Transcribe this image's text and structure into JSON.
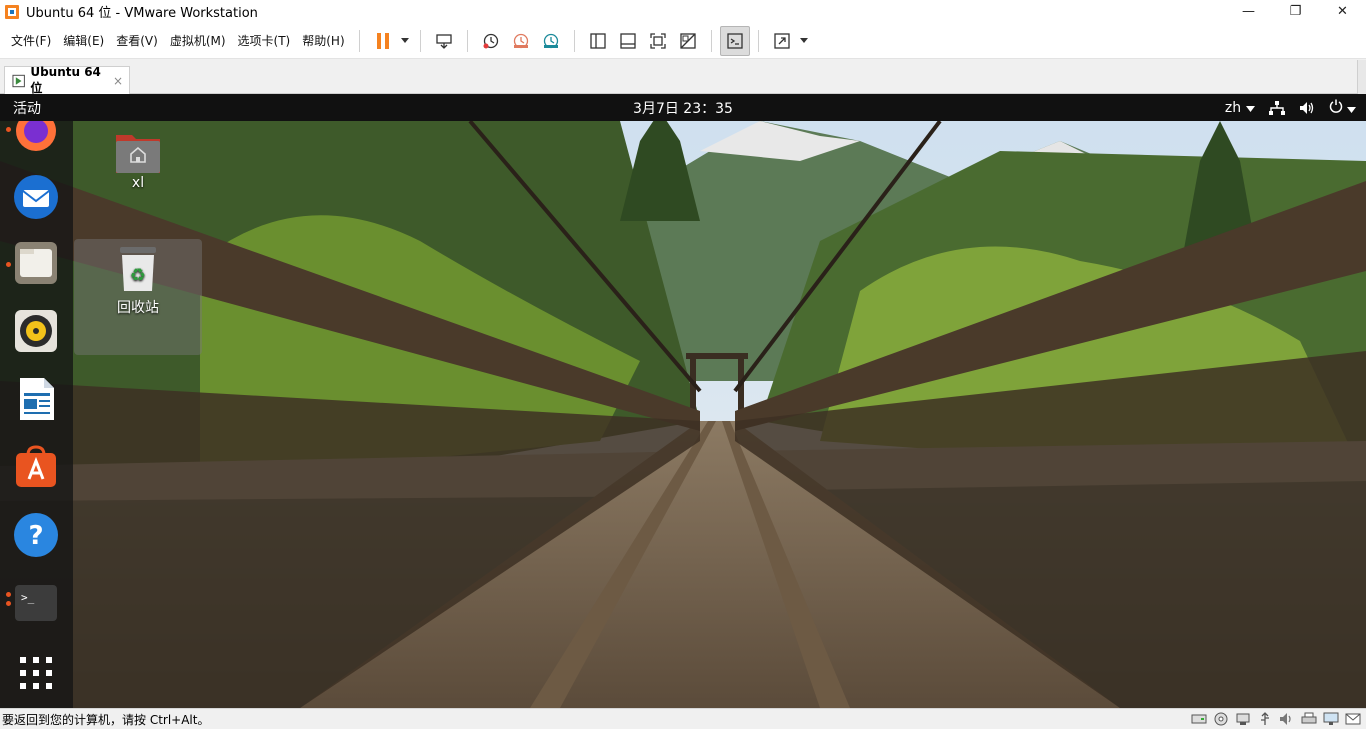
{
  "window": {
    "title": "Ubuntu 64 位 - VMware Workstation",
    "minimize": "—",
    "restore": "❐",
    "close": "✕"
  },
  "menu": [
    "文件(F)",
    "编辑(E)",
    "查看(V)",
    "虚拟机(M)",
    "选项卡(T)",
    "帮助(H)"
  ],
  "toolbar": {
    "icons": [
      "pause-icon",
      "send-ctrl-alt-del-icon",
      "snapshot-take-icon",
      "snapshot-revert-icon",
      "snapshot-manager-icon",
      "library-view-icon",
      "console-view-icon",
      "fullscreen-icon",
      "unity-icon",
      "terminal-view-icon",
      "stretch-guest-icon"
    ]
  },
  "tab": {
    "label": "Ubuntu 64 位",
    "close": "×"
  },
  "guest": {
    "activities": "活动",
    "clock": "3月7日  23：35",
    "language": "zh",
    "desktop_icons": [
      {
        "label": "xl"
      },
      {
        "label": "回收站"
      }
    ],
    "dock_items": [
      "firefox",
      "thunderbird",
      "files",
      "rhythmbox",
      "libreoffice-writer",
      "ubuntu-software",
      "help",
      "terminal",
      "show-applications"
    ]
  },
  "status": {
    "hint": "要返回到您的计算机，请按 Ctrl+Alt。"
  },
  "colors": {
    "accent": "#e95420",
    "pause": "#f58220",
    "topbar": "#111111"
  }
}
